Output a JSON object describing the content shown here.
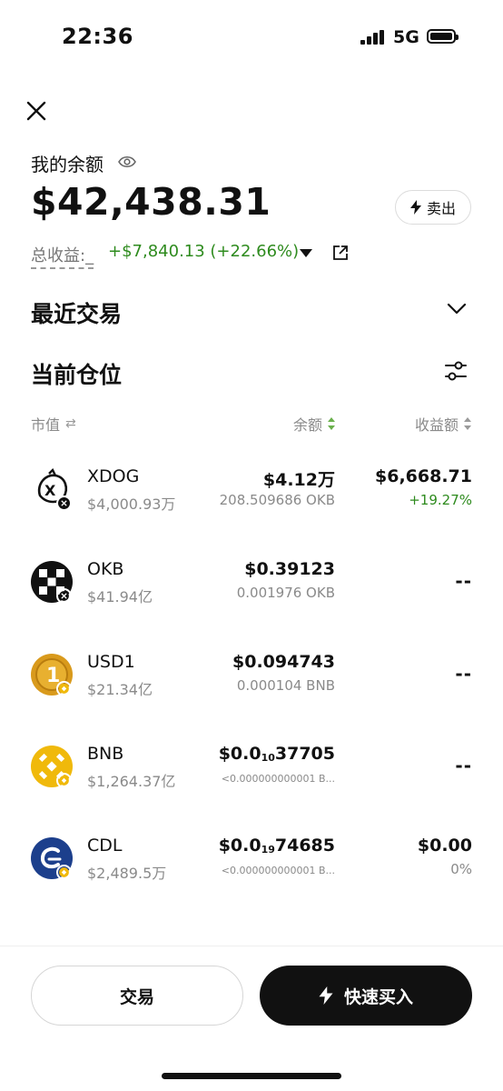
{
  "status_bar": {
    "time": "22:36",
    "network": "5G"
  },
  "header": {
    "balance_label": "我的余额",
    "balance": "$42,438.31",
    "sell_label": "卖出",
    "pnl_label": "总收益",
    "pnl_value": "+$7,840.13 (+22.66%)"
  },
  "sections": {
    "recent_trades": "最近交易",
    "positions": "当前仓位"
  },
  "columns": {
    "market_cap": "市值",
    "balance": "余额",
    "pnl": "收益额"
  },
  "tokens": [
    {
      "symbol": "XDOG",
      "market_cap": "$4,000.93万",
      "balance": "$4.12万",
      "amount": "208.509686 OKB",
      "pnl": "$6,668.71",
      "pnl_pct": "+19.27%"
    },
    {
      "symbol": "OKB",
      "market_cap": "$41.94亿",
      "balance": "$0.39123",
      "amount": "0.001976 OKB",
      "pnl": "--"
    },
    {
      "symbol": "USD1",
      "market_cap": "$21.34亿",
      "balance": "$0.094743",
      "amount": "0.000104 BNB",
      "pnl": "--"
    },
    {
      "symbol": "BNB",
      "market_cap": "$1,264.37亿",
      "balance_prefix": "$0.0",
      "balance_zeros": "10",
      "balance_digits": "37705",
      "amount": "<0.000000000001 B...",
      "pnl": "--"
    },
    {
      "symbol": "CDL",
      "market_cap": "$2,489.5万",
      "balance_prefix": "$0.0",
      "balance_zeros": "19",
      "balance_digits": "74685",
      "amount": "<0.000000000001 B...",
      "pnl": "$0.00",
      "pnl_pct": "0%"
    }
  ],
  "footer": {
    "trade_label": "交易",
    "quick_buy_label": "快速买入"
  },
  "colors": {
    "positive": "#2e8b1e",
    "sort_active": "#6ab04c",
    "bnb_yellow": "#f0b90b",
    "usd1_gold": "#d99a1c",
    "cdl_navy": "#1c3f8c"
  }
}
